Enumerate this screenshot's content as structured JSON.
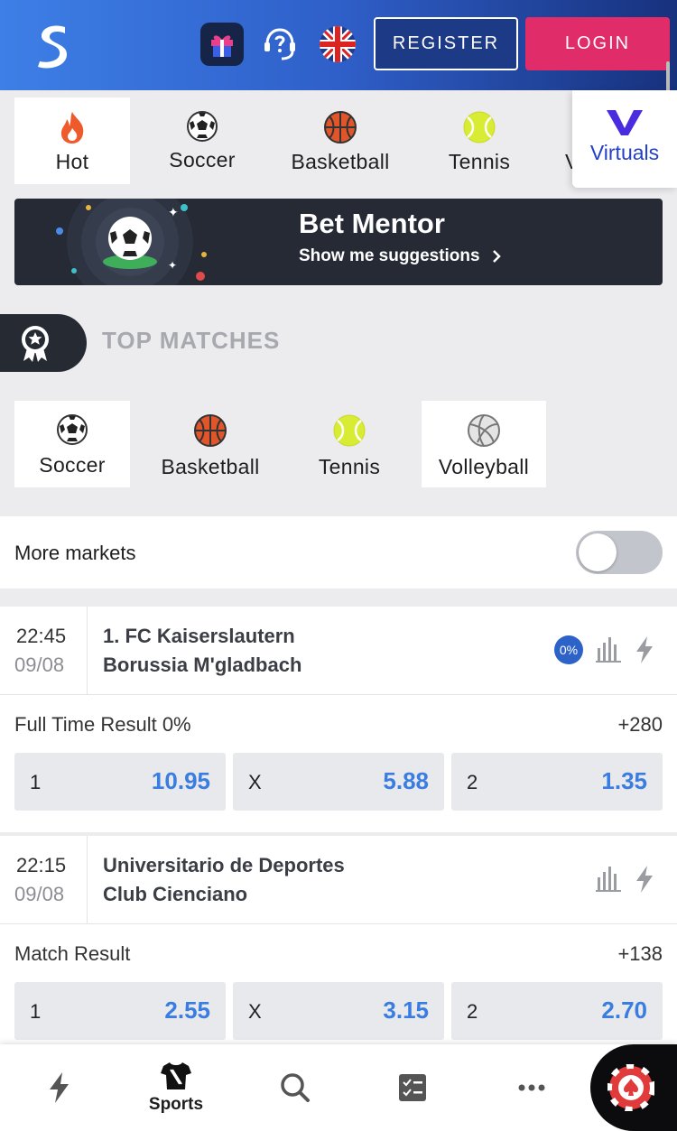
{
  "header": {
    "register_label": "REGISTER",
    "login_label": "LOGIN",
    "brand_color": "#2f5fc9",
    "login_color": "#e02d6a"
  },
  "sports_nav": {
    "items": [
      {
        "label": "Hot",
        "icon": "flame-icon"
      },
      {
        "label": "Soccer",
        "icon": "soccer-ball-icon"
      },
      {
        "label": "Basketball",
        "icon": "basketball-icon"
      },
      {
        "label": "Tennis",
        "icon": "tennis-ball-icon"
      },
      {
        "label": "V",
        "icon": "partial"
      }
    ],
    "virtuals_label": "Virtuals",
    "active": "Hot"
  },
  "bet_mentor": {
    "title": "Bet Mentor",
    "subtitle": "Show me suggestions"
  },
  "top_matches": {
    "title": "TOP MATCHES",
    "tabs": [
      {
        "label": "Soccer",
        "icon": "soccer-ball-icon"
      },
      {
        "label": "Basketball",
        "icon": "basketball-icon"
      },
      {
        "label": "Tennis",
        "icon": "tennis-ball-icon"
      },
      {
        "label": "Volleyball",
        "icon": "volleyball-icon"
      }
    ],
    "active": "Soccer"
  },
  "more_markets": {
    "label": "More markets",
    "enabled": false
  },
  "matches": [
    {
      "time": "22:45",
      "date": "09/08",
      "home": "1. FC Kaiserslautern",
      "away": "Borussia M'gladbach",
      "badge": "0%",
      "market": "Full Time Result 0%",
      "more": "+280",
      "odds": [
        {
          "key": "1",
          "value": "10.95"
        },
        {
          "key": "X",
          "value": "5.88"
        },
        {
          "key": "2",
          "value": "1.35"
        }
      ]
    },
    {
      "time": "22:15",
      "date": "09/08",
      "home": "Universitario de Deportes",
      "away": "Club Cienciano",
      "market": "Match Result",
      "more": "+138",
      "odds": [
        {
          "key": "1",
          "value": "2.55"
        },
        {
          "key": "X",
          "value": "3.15"
        },
        {
          "key": "2",
          "value": "2.70"
        }
      ]
    }
  ],
  "bottom_nav": {
    "sports_label": "Sports"
  }
}
